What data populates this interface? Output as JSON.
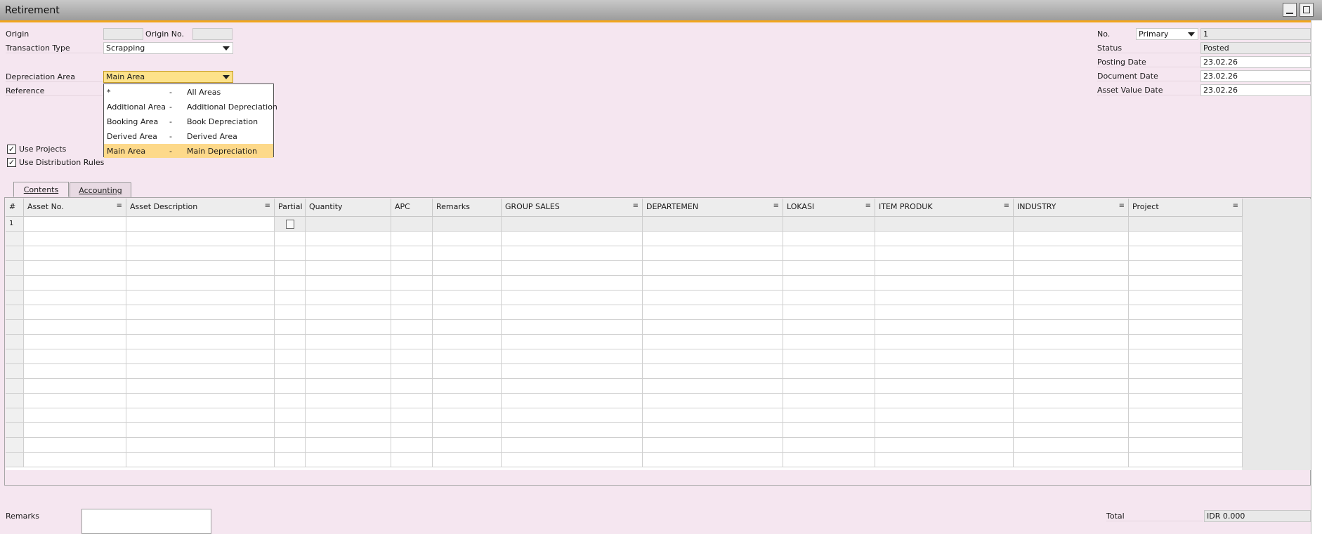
{
  "window": {
    "title": "Retirement"
  },
  "header_left": {
    "origin_label": "Origin",
    "origin_value": "",
    "origin_no_label": "Origin No.",
    "origin_no_value": "",
    "transaction_type_label": "Transaction Type",
    "transaction_type_value": "Scrapping",
    "depreciation_area_label": "Depreciation Area",
    "depreciation_area_value": "Main Area",
    "reference_label": "Reference"
  },
  "depreciation_dropdown": {
    "items": [
      {
        "code": "*",
        "sep": "-",
        "desc": "All Areas"
      },
      {
        "code": "Additional Area",
        "sep": "-",
        "desc": "Additional Depreciation"
      },
      {
        "code": "Booking Area",
        "sep": "-",
        "desc": "Book Depreciation"
      },
      {
        "code": "Derived Area",
        "sep": "-",
        "desc": "Derived Area"
      },
      {
        "code": "Main Area",
        "sep": "-",
        "desc": "Main Depreciation"
      }
    ],
    "selected_index": 4
  },
  "checkboxes": {
    "use_projects": "Use Projects",
    "use_distribution_rules": "Use Distribution Rules"
  },
  "header_right": {
    "no_label": "No.",
    "series_value": "Primary",
    "no_value": "1",
    "status_label": "Status",
    "status_value": "Posted",
    "posting_date_label": "Posting Date",
    "posting_date_value": "23.02.26",
    "document_date_label": "Document Date",
    "document_date_value": "23.02.26",
    "asset_value_date_label": "Asset Value Date",
    "asset_value_date_value": "23.02.26"
  },
  "tabs": {
    "contents": "Contents",
    "accounting": "Accounting"
  },
  "table": {
    "headers": [
      "#",
      "Asset No.",
      "Asset Description",
      "Partial",
      "Quantity",
      "APC",
      "Remarks",
      "GROUP SALES",
      "DEPARTEMEN",
      "LOKASI",
      "ITEM PRODUK",
      "INDUSTRY",
      "Project"
    ],
    "menu_glyph": "≡",
    "first_row_number": "1"
  },
  "footer": {
    "remarks_label": "Remarks",
    "total_label": "Total",
    "total_value": "IDR 0.000"
  }
}
